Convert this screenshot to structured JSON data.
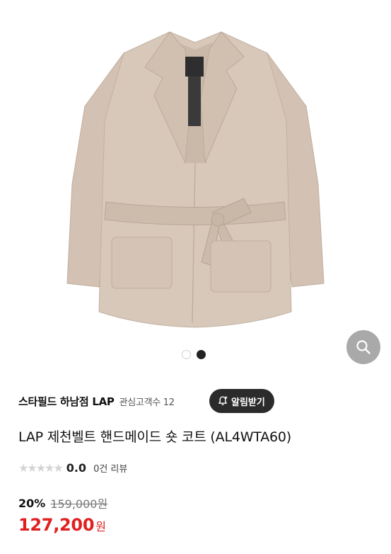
{
  "product_image": {
    "alt": ""
  },
  "carousel": {
    "total": 2,
    "active_index": 1
  },
  "zoom": {
    "icon": "search-icon"
  },
  "store": {
    "name": "스타필드 하남점 LAP",
    "followers_label": "관심고객수 12"
  },
  "alarm_button": {
    "label": "알림받기",
    "icon": "bell-plus-icon"
  },
  "product": {
    "title": "LAP 제천벨트 핸드메이드 숏 코트 (AL4WTA60)"
  },
  "rating": {
    "stars": "★★★★★",
    "score": "0.0",
    "reviews": "0건 리뷰"
  },
  "price": {
    "discount": "20%",
    "original": "159,000원",
    "final": "127,200",
    "unit": "원"
  },
  "colors": {
    "final_price": "#e02020",
    "alarm_bg": "#2b2b2b",
    "zoom_bg": "#a9a9a9",
    "coat": "#d6c5b6"
  }
}
